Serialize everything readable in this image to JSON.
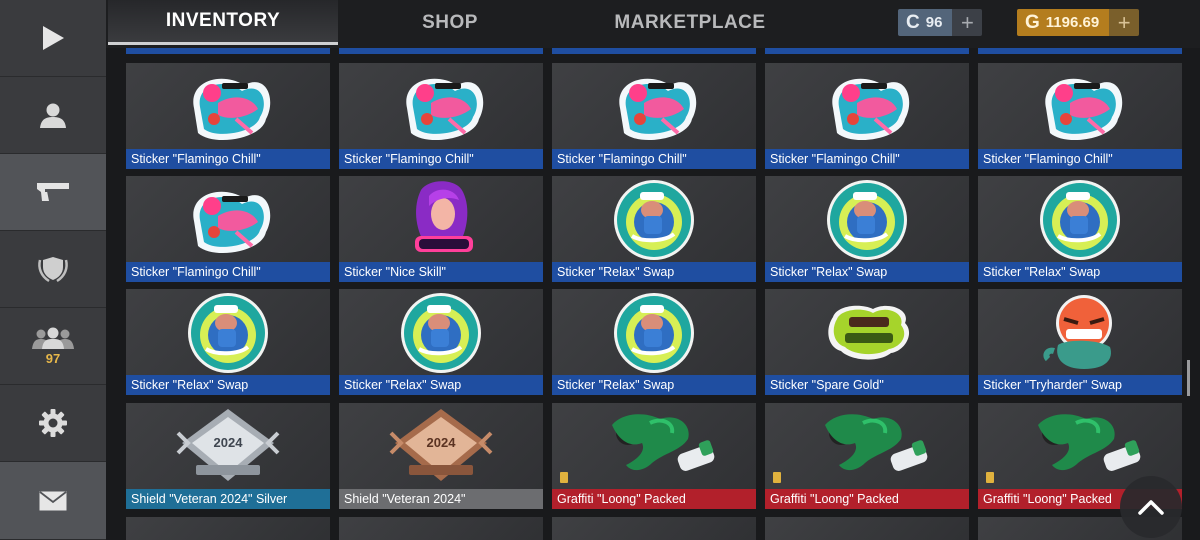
{
  "tabs": [
    {
      "label": "INVENTORY",
      "active": true
    },
    {
      "label": "SHOP",
      "active": false
    },
    {
      "label": "MARKETPLACE",
      "active": false
    }
  ],
  "currency": {
    "silver": {
      "symbol": "C",
      "amount": "96",
      "plus": "+"
    },
    "gold": {
      "symbol": "G",
      "amount": "1196.69",
      "plus": "+"
    }
  },
  "sidebar": {
    "items": [
      {
        "icon": "play-icon"
      },
      {
        "icon": "user-icon"
      },
      {
        "icon": "pistol-icon",
        "active": true
      },
      {
        "icon": "shield-laurel-icon"
      },
      {
        "icon": "friends-icon",
        "count": "97"
      },
      {
        "icon": "gear-icon"
      },
      {
        "icon": "mail-icon",
        "active": true
      }
    ]
  },
  "items": [
    {
      "name": "Sticker \"Flamingo Chill\"",
      "art": "flamingo",
      "bar": "blue"
    },
    {
      "name": "Sticker \"Flamingo Chill\"",
      "art": "flamingo",
      "bar": "blue"
    },
    {
      "name": "Sticker \"Flamingo Chill\"",
      "art": "flamingo",
      "bar": "blue"
    },
    {
      "name": "Sticker \"Flamingo Chill\"",
      "art": "flamingo",
      "bar": "blue"
    },
    {
      "name": "Sticker \"Flamingo Chill\"",
      "art": "flamingo",
      "bar": "blue"
    },
    {
      "name": "Sticker \"Flamingo Chill\"",
      "art": "flamingo",
      "bar": "blue"
    },
    {
      "name": "Sticker \"Nice Skill\"",
      "art": "niceskill",
      "bar": "blue"
    },
    {
      "name": "Sticker \"Relax\" Swap",
      "art": "relax",
      "bar": "blue"
    },
    {
      "name": "Sticker \"Relax\" Swap",
      "art": "relax",
      "bar": "blue"
    },
    {
      "name": "Sticker \"Relax\" Swap",
      "art": "relax",
      "bar": "blue"
    },
    {
      "name": "Sticker \"Relax\" Swap",
      "art": "relax",
      "bar": "blue"
    },
    {
      "name": "Sticker \"Relax\" Swap",
      "art": "relax",
      "bar": "blue"
    },
    {
      "name": "Sticker \"Relax\" Swap",
      "art": "relax",
      "bar": "blue"
    },
    {
      "name": "Sticker \"Spare Gold\"",
      "art": "sparegold",
      "bar": "blue"
    },
    {
      "name": "Sticker \"Tryharder\" Swap",
      "art": "tryharder",
      "bar": "blue"
    },
    {
      "name": "Shield \"Veteran 2024\" Silver",
      "art": "shield-silver",
      "bar": "cyan",
      "year": "2024"
    },
    {
      "name": "Shield \"Veteran 2024\"",
      "art": "shield-bronze",
      "bar": "grey",
      "year": "2024"
    },
    {
      "name": "Graffiti \"Loong\" Packed",
      "art": "graffiti",
      "bar": "red"
    },
    {
      "name": "Graffiti \"Loong\" Packed",
      "art": "graffiti",
      "bar": "red"
    },
    {
      "name": "Graffiti \"Loong\" Packed",
      "art": "graffiti",
      "bar": "red"
    }
  ],
  "colors": {
    "bar_blue": "#1f4ea1",
    "bar_cyan": "#1f6f97",
    "bar_grey": "#6c6d70",
    "bar_red": "#b2202b",
    "gold": "#b47d1e",
    "silver": "#53657a"
  }
}
